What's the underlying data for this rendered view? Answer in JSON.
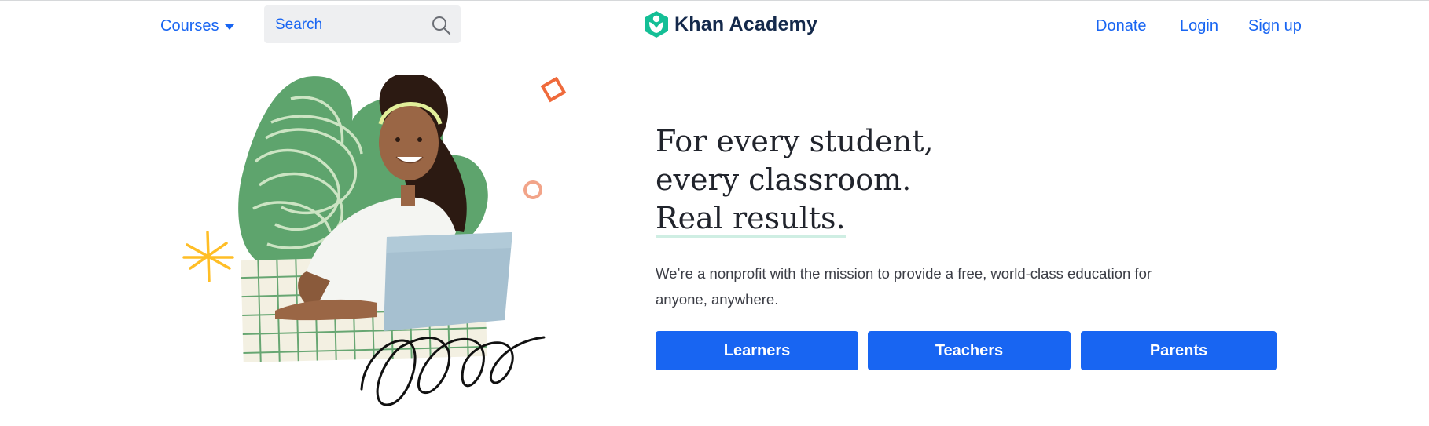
{
  "header": {
    "courses_label": "Courses",
    "search_placeholder": "Search",
    "logo_text": "Khan Academy",
    "donate_label": "Donate",
    "login_label": "Login",
    "signup_label": "Sign up"
  },
  "hero": {
    "headline_line1": "For every student,",
    "headline_line2": "every classroom.",
    "headline_line3": "Real results.",
    "subtext": "We’re a nonprofit with the mission to provide a free, world-class education for anyone, anywhere.",
    "buttons": [
      {
        "label": "Learners"
      },
      {
        "label": "Teachers"
      },
      {
        "label": "Parents"
      }
    ]
  },
  "colors": {
    "accent": "#1865f2",
    "brand_green": "#14bf96",
    "logo_text": "#14294b",
    "headline_underline": "#cfeee3"
  },
  "icons": {
    "search": "search-icon",
    "courses_caret": "caret-down-icon",
    "logo": "khan-academy-logo-icon"
  }
}
